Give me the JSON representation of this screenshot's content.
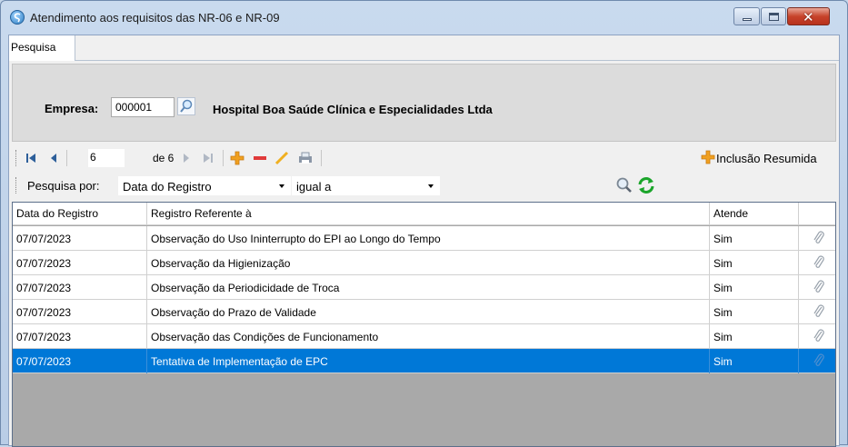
{
  "window": {
    "title": "Atendimento aos requisitos das NR-06 e NR-09",
    "icon": "app-logo-icon",
    "controls": [
      "minimize-icon",
      "maximize-icon",
      "close-icon"
    ],
    "close_glyph": "✕"
  },
  "tabs": [
    {
      "label": "Pesquisa",
      "active": true
    }
  ],
  "empresa": {
    "label": "Empresa:",
    "code": "000001",
    "name": "Hospital Boa Saúde Clínica e Especialidades Ltda",
    "lookup_icon": "search-icon"
  },
  "navigator": {
    "current_position": "6",
    "total_text": "de 6",
    "inclusao_label": "Inclusão Resumida",
    "icons": [
      "first-record-icon",
      "prev-record-icon",
      "next-record-icon",
      "last-record-icon",
      "add-icon",
      "delete-icon",
      "edit-icon",
      "print-icon"
    ]
  },
  "filter": {
    "label": "Pesquisa por:",
    "field": "Data do Registro",
    "operator": "igual a",
    "icons": [
      "search-icon",
      "refresh-icon"
    ]
  },
  "grid": {
    "columns": [
      "Data do Registro",
      "Registro Referente à",
      "Atende",
      ""
    ],
    "rows": [
      {
        "data": "07/07/2023",
        "registro": "Observação do Uso Ininterrupto do EPI ao Longo do Tempo",
        "atende": "Sim"
      },
      {
        "data": "07/07/2023",
        "registro": "Observação da Higienização",
        "atende": "Sim"
      },
      {
        "data": "07/07/2023",
        "registro": "Observação da Periodicidade de Troca",
        "atende": "Sim"
      },
      {
        "data": "07/07/2023",
        "registro": "Observação do Prazo de Validade",
        "atende": "Sim"
      },
      {
        "data": "07/07/2023",
        "registro": "Observação das Condições de Funcionamento",
        "atende": "Sim"
      },
      {
        "data": "07/07/2023",
        "registro": "Tentativa de Implementação de EPC",
        "atende": "Sim"
      }
    ],
    "selected_row": 5,
    "attachment_icon": "paperclip-icon"
  },
  "colors": {
    "selection": "#0078d7",
    "add": "#f0a020",
    "delete": "#e03a3a",
    "edit": "#f0b020",
    "refresh": "#1aa52a"
  }
}
